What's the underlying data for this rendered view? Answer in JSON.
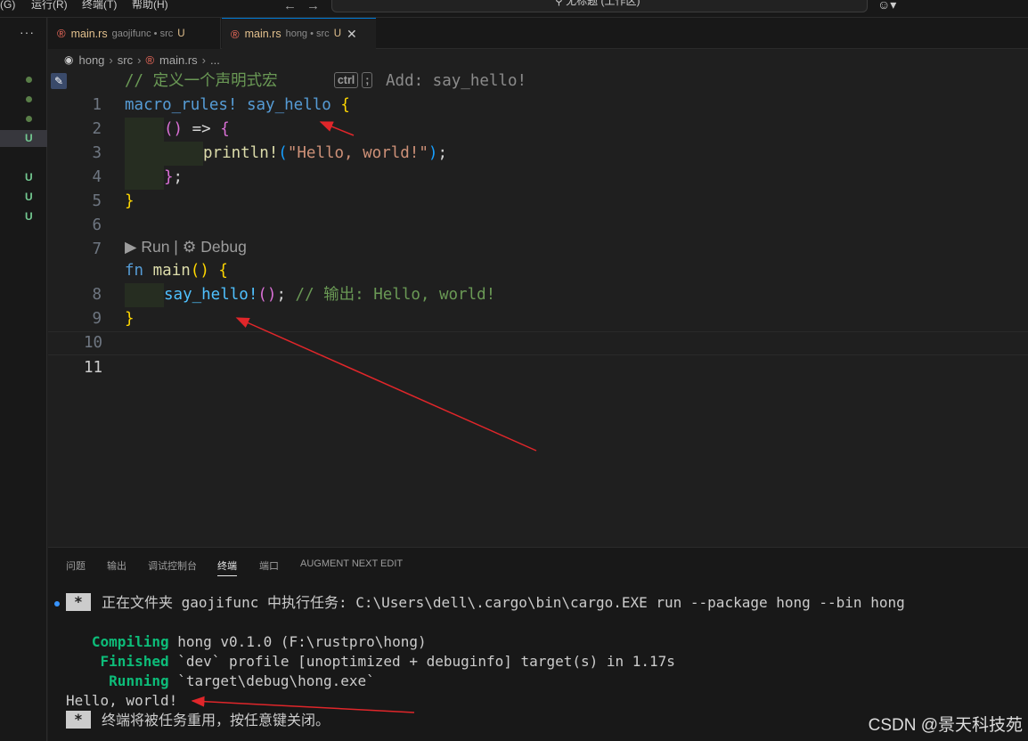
{
  "menubar": {
    "items": [
      "(G)",
      "运行(R)",
      "终端(T)",
      "帮助(H)"
    ],
    "search_text": "无标题 (工作区)"
  },
  "sidebar": {
    "more_label": "···",
    "markers": [
      "U",
      "U",
      "U",
      "U"
    ]
  },
  "tabs": [
    {
      "name": "main.rs",
      "description": "gaojifunc • src",
      "status": "U",
      "active": false
    },
    {
      "name": "main.rs",
      "description": "hong • src",
      "status": "U",
      "active": true,
      "close": "✕"
    }
  ],
  "breadcrumb": [
    "hong",
    "src",
    "main.rs",
    "..."
  ],
  "editor": {
    "line_numbers": [
      "1",
      "2",
      "3",
      "4",
      "5",
      "6",
      "7",
      "8",
      "9",
      "10",
      "11"
    ],
    "code": {
      "l1_comment": "// 定义一个声明式宏",
      "l1_ghost_key1": "ctrl",
      "l1_ghost_key2": ";",
      "l1_ghost_text": "Add: say_hello!",
      "l2_kw": "macro_rules!",
      "l2_name": "say_hello",
      "l2_brace": "{",
      "l3_paren": "()",
      "l3_arrow": " => ",
      "l3_brace": "{",
      "l4_macro": "println!",
      "l4_open": "(",
      "l4_str": "\"Hello, world!\"",
      "l4_close": ")",
      "l4_semi": ";",
      "l5_brace": "}",
      "l5_semi": ";",
      "l6_brace": "}",
      "l8_kw": "fn",
      "l8_name": "main",
      "l8_paren": "()",
      "l8_brace": "{",
      "l9_macro": "say_hello!",
      "l9_paren": "()",
      "l9_semi": ";",
      "l9_comment": "// 输出: Hello, world!",
      "l10_brace": "}"
    },
    "codelens": {
      "run": "▶ Run",
      "sep": " | ",
      "debug": "⚙ Debug"
    }
  },
  "panel": {
    "tabs": [
      "问题",
      "输出",
      "调试控制台",
      "终端",
      "端口",
      "AUGMENT NEXT EDIT"
    ],
    "active_tab": "终端",
    "terminal": {
      "task_star": "*",
      "task_line": "正在文件夹 gaojifunc 中执行任务: C:\\Users\\dell\\.cargo\\bin\\cargo.EXE run --package hong --bin hong",
      "compiling_label": "Compiling",
      "compiling_text": " hong v0.1.0 (F:\\rustpro\\hong)",
      "finished_label": "Finished",
      "finished_text": " `dev` profile [unoptimized + debuginfo] target(s) in 1.17s",
      "running_label": "Running",
      "running_text": " `target\\debug\\hong.exe`",
      "output": "Hello, world!",
      "end_star": "*",
      "end_line": "终端将被任务重用，按任意键关闭。"
    }
  },
  "watermark": "CSDN @景天科技苑",
  "colors": {
    "accent": "#0078d4",
    "annotation_arrow": "#e0262a"
  }
}
